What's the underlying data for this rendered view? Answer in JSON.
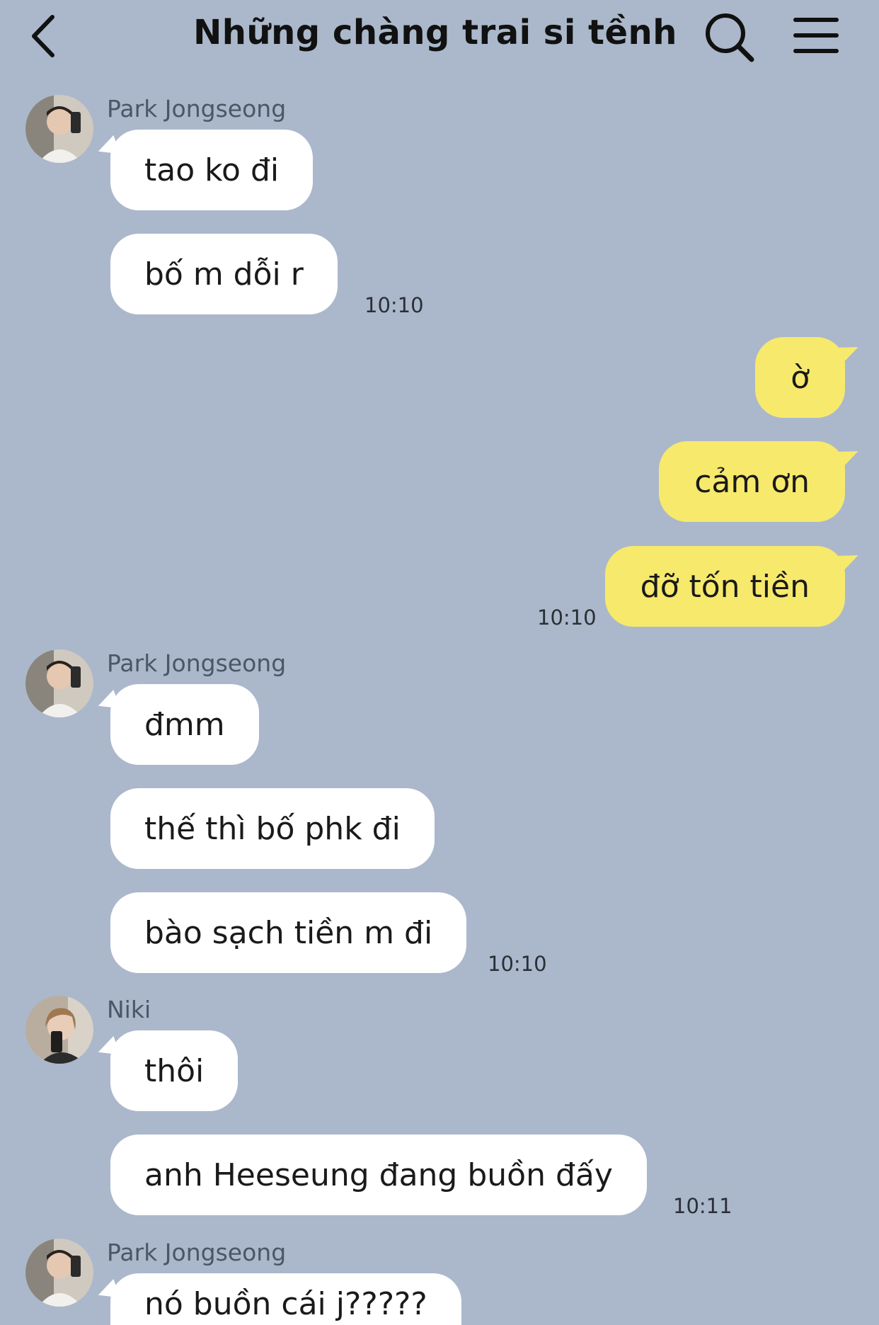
{
  "header": {
    "title": "Những chàng trai si tềnh",
    "back_icon": "chevron-left-icon",
    "search_icon": "search-icon",
    "menu_icon": "hamburger-menu-icon"
  },
  "colors": {
    "background": "#abb8cb",
    "incoming_bubble": "#ffffff",
    "outgoing_bubble": "#f7e96c"
  },
  "messages": [
    {
      "group": 0,
      "sender": "Park Jongseong",
      "texts": [
        "tao ko đi",
        "bố m dỗi r"
      ],
      "time": "10:10"
    },
    {
      "group": 1,
      "outgoing": true,
      "texts": [
        "ờ",
        "cảm ơn",
        "đỡ tốn tiền"
      ],
      "time": "10:10"
    },
    {
      "group": 2,
      "sender": "Park Jongseong",
      "texts": [
        "đmm",
        "thế thì bố phk đi",
        "bào sạch tiền m đi"
      ],
      "time": "10:10"
    },
    {
      "group": 3,
      "sender": "Niki",
      "texts": [
        "thôi",
        "anh Heeseung đang buồn đấy"
      ],
      "time": "10:11"
    },
    {
      "group": 4,
      "sender": "Park Jongseong",
      "texts": [
        "nó buồn cái j?????"
      ]
    }
  ]
}
